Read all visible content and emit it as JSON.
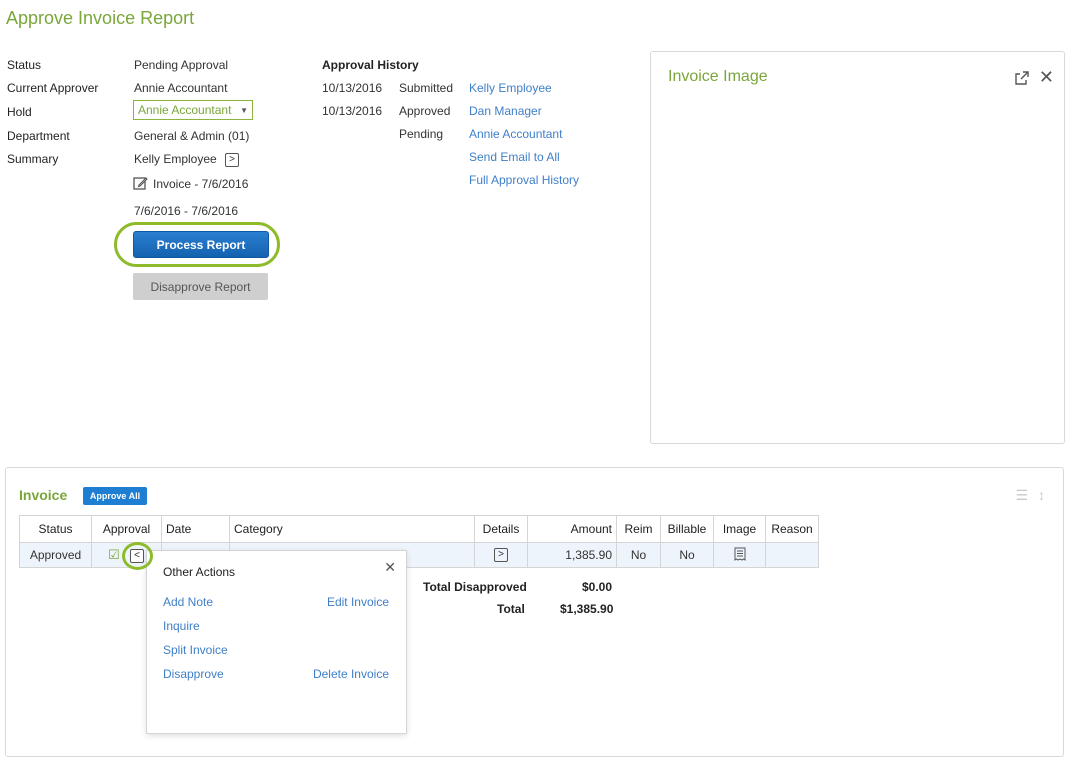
{
  "page_title": "Approve Invoice Report",
  "report": {
    "status_label": "Status",
    "status_value": "Pending Approval",
    "approver_label": "Current Approver",
    "approver_value": "Annie Accountant",
    "hold_label": "Hold",
    "hold_value": "Annie Accountant",
    "department_label": "Department",
    "department_value": "General & Admin (01)",
    "summary_label": "Summary",
    "summary_employee": "Kelly Employee",
    "summary_invoice": "Invoice - 7/6/2016",
    "summary_dates": "7/6/2016 - 7/6/2016",
    "process_label": "Process Report",
    "disapprove_label": "Disapprove Report"
  },
  "history": {
    "title": "Approval History",
    "rows": [
      {
        "date": "10/13/2016",
        "action": "Submitted",
        "person": "Kelly Employee"
      },
      {
        "date": "10/13/2016",
        "action": "Approved",
        "person": "Dan Manager"
      },
      {
        "date": "",
        "action": "Pending",
        "person": "Annie Accountant"
      }
    ],
    "send_email": "Send Email to All",
    "full_history": "Full Approval History"
  },
  "image_panel": {
    "title": "Invoice Image",
    "open_icon": "external-link-icon",
    "close_icon": "close-icon"
  },
  "invoice": {
    "title": "Invoice",
    "approve_all": "Approve All",
    "columns": [
      "Status",
      "Approval",
      "Date",
      "Category",
      "Details",
      "Amount",
      "Reim",
      "Billable",
      "Image",
      "Reason"
    ],
    "row": {
      "status": "Approved",
      "date": "",
      "category": "",
      "amount": "1,385.90",
      "reim": "No",
      "billable": "No",
      "reason": ""
    },
    "total_disapproved_label": "Total Disapproved",
    "total_disapproved_value": "$0.00",
    "total_label": "Total",
    "total_value": "$1,385.90"
  },
  "other_actions": {
    "title": "Other Actions",
    "add_note": "Add Note",
    "edit_invoice": "Edit Invoice",
    "inquire": "Inquire",
    "split_invoice": "Split Invoice",
    "disapprove": "Disapprove",
    "delete_invoice": "Delete Invoice"
  },
  "colors": {
    "accent_green": "#7aa63a",
    "link_blue": "#3f7fc8",
    "primary_button": "#1462b0",
    "highlight_ring": "#8dbb2a"
  }
}
